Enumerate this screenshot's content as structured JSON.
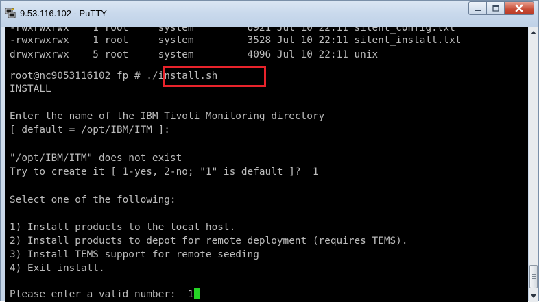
{
  "window": {
    "title": "9.53.116.102 - PuTTY",
    "icon": "putty-icon",
    "buttons": [
      "minimize-icon",
      "maximize-icon",
      "close-icon"
    ]
  },
  "terminal": {
    "lines": [
      "-rwxrwxrwx    1 root     system         6921 Jul 10 22:11 silent_config.txt",
      "-rwxrwxrwx    1 root     system         3528 Jul 10 22:11 silent_install.txt",
      "drwxrwxrwx    5 root     system         4096 Jul 10 22:11 unix",
      "root@nc9053116102 fp # ./install.sh",
      "INSTALL",
      "",
      "Enter the name of the IBM Tivoli Monitoring directory",
      "[ default = /opt/IBM/ITM ]:",
      "",
      "\"/opt/IBM/ITM\" does not exist",
      "Try to create it [ 1-yes, 2-no; \"1\" is default ]?  1",
      "",
      "Select one of the following:",
      "",
      "1) Install products to the local host.",
      "2) Install products to depot for remote deployment (requires TEMS).",
      "3) Install TEMS support for remote seeding",
      "4) Exit install.",
      "",
      "Please enter a valid number:  1"
    ],
    "highlighted_command": "./install.sh",
    "colors": {
      "background": "#000000",
      "text": "#bbbbbb",
      "cursor": "#25d425",
      "highlight_border": "#e8232b"
    }
  }
}
